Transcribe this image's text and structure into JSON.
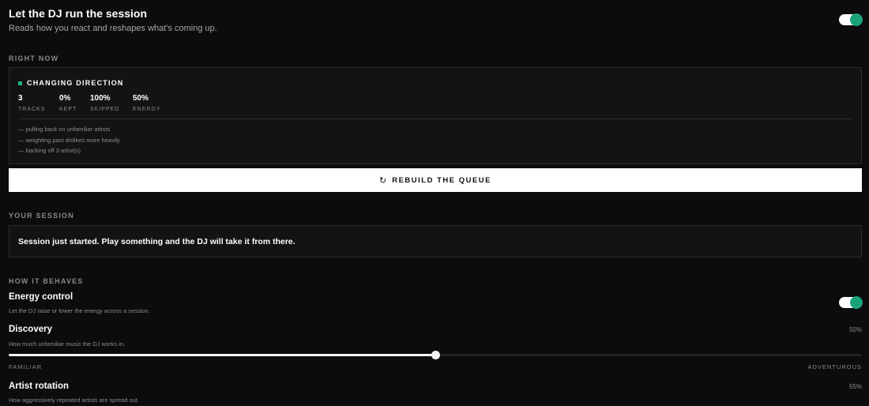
{
  "header": {
    "title": "Let the DJ run the session",
    "subtitle": "Reads how you react and reshapes what's coming up.",
    "enabled": true
  },
  "right_now": {
    "section_label": "RIGHT NOW",
    "state_label": "CHANGING DIRECTION",
    "stats": [
      {
        "value": "3",
        "label": "TRACKS"
      },
      {
        "value": "0%",
        "label": "KEPT"
      },
      {
        "value": "100%",
        "label": "SKIPPED"
      },
      {
        "value": "50%",
        "label": "ENERGY"
      }
    ],
    "notes": [
      "— pulling back on unfamiliar artists",
      "— weighting past dislikes more heavily",
      "— backing off 3 artist(s)"
    ]
  },
  "rebuild_button": {
    "icon": "refresh-icon",
    "label": "REBUILD THE QUEUE"
  },
  "session": {
    "section_label": "YOUR SESSION",
    "text": "Session just started. Play something and the DJ will take it from there."
  },
  "behaviour": {
    "section_label": "HOW IT BEHAVES",
    "energy": {
      "title": "Energy control",
      "description": "Let the DJ raise or lower the energy across a session.",
      "enabled": true
    },
    "discovery": {
      "title": "Discovery",
      "description": "How much unfamiliar music the DJ works in.",
      "value_label": "50%",
      "value": 0.5,
      "min_label": "FAMILIAR",
      "max_label": "ADVENTUROUS"
    },
    "rotation": {
      "title": "Artist rotation",
      "description": "How aggressively repeated artists are spread out.",
      "value_label": "55%"
    }
  },
  "colors": {
    "background": "#0c0b0d",
    "accent": "#1db584",
    "card": "#131214"
  }
}
